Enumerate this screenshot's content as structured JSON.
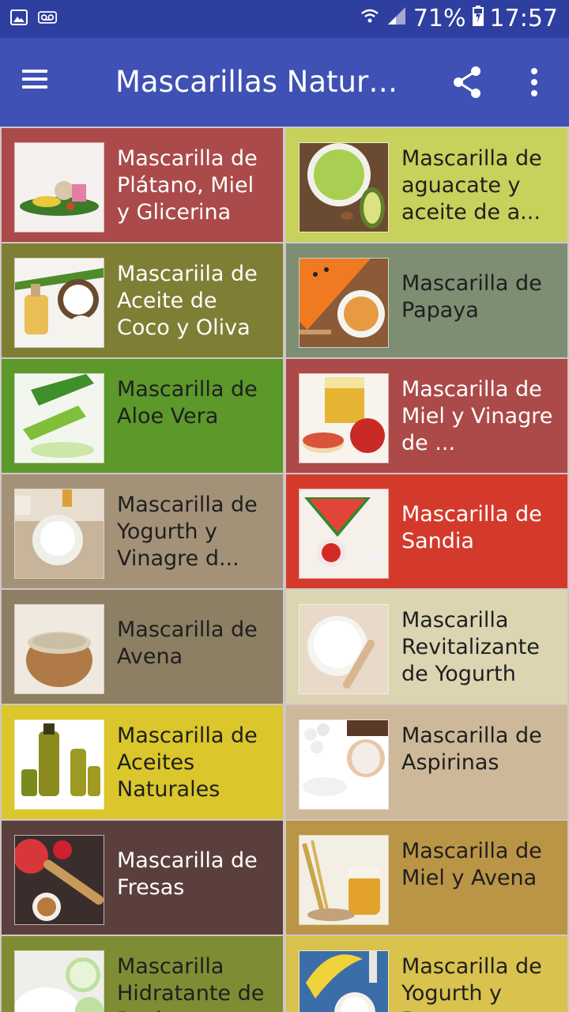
{
  "status_bar": {
    "battery": "71%",
    "time": "17:57"
  },
  "app_bar": {
    "title": "Mascarillas Naturales"
  },
  "items": [
    {
      "label": "Mascarilla de Plátano, Miel y Glicerina",
      "bg": "#ab4a4a",
      "fg": "#ffffff"
    },
    {
      "label": "Mascarilla de aguacate y aceite de a...",
      "bg": "#c7d15b",
      "fg": "#1f1f1f"
    },
    {
      "label": "Mascariila de Aceite de Coco y Oliva",
      "bg": "#7f7e35",
      "fg": "#ffffff"
    },
    {
      "label": "Mascarilla de Papaya",
      "bg": "#7e8e73",
      "fg": "#1f1f1f"
    },
    {
      "label": "Mascarilla de Aloe Vera",
      "bg": "#5c982a",
      "fg": "#1f1f1f"
    },
    {
      "label": "Mascarilla de Miel y Vinagre de ...",
      "bg": "#ab4a48",
      "fg": "#ffffff"
    },
    {
      "label": "Mascarilla de Yogurth y Vinagre d...",
      "bg": "#a39278",
      "fg": "#1f1f1f"
    },
    {
      "label": "Mascarilla de Sandia",
      "bg": "#d33a2b",
      "fg": "#ffffff"
    },
    {
      "label": "Mascarilla de Avena",
      "bg": "#8d7f63",
      "fg": "#1f1f1f"
    },
    {
      "label": "Mascarilla Revitalizante de Yogurth",
      "bg": "#ddd5b2",
      "fg": "#1f1f1f"
    },
    {
      "label": "Mascarilla de Aceites Naturales",
      "bg": "#dbc62b",
      "fg": "#1f1f1f"
    },
    {
      "label": "Mascarilla de Aspirinas",
      "bg": "#cdb99a",
      "fg": "#1f1f1f"
    },
    {
      "label": "Mascarilla de Fresas",
      "bg": "#5a3f3c",
      "fg": "#ffffff"
    },
    {
      "label": "Mascarilla de Miel y Avena",
      "bg": "#bb9546",
      "fg": "#1f1f1f"
    },
    {
      "label": "Mascarilla Hidratante de Pepino",
      "bg": "#7f8c33",
      "fg": "#1f1f1f"
    },
    {
      "label": "Mascarilla de Yogurth y Banana",
      "bg": "#d9c24d",
      "fg": "#1f1f1f"
    }
  ]
}
